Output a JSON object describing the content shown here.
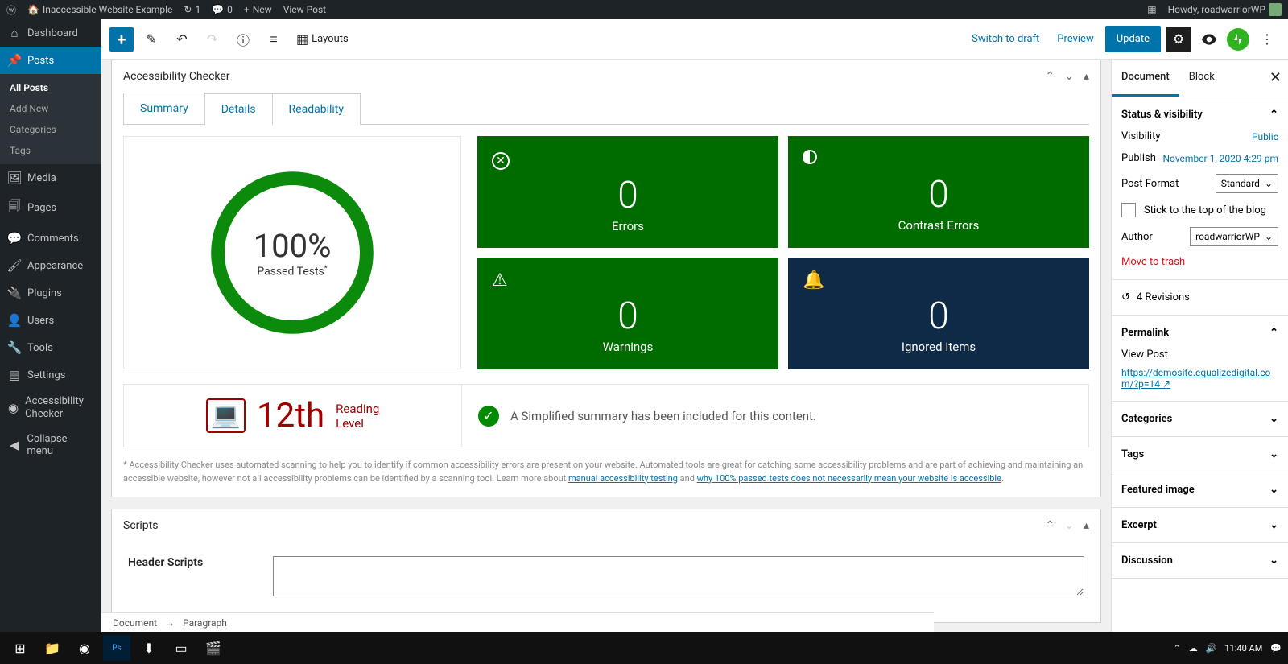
{
  "adminbar": {
    "site_title": "Inaccessible Website Example",
    "updates_count": "1",
    "comments_count": "0",
    "new_label": "New",
    "view_post": "View Post",
    "howdy": "Howdy, roadwarriorWP"
  },
  "sidebar": {
    "items": [
      {
        "icon": "dashboard",
        "label": "Dashboard"
      },
      {
        "icon": "posts",
        "label": "Posts",
        "active": true
      },
      {
        "icon": "media",
        "label": "Media"
      },
      {
        "icon": "pages",
        "label": "Pages"
      },
      {
        "icon": "comments",
        "label": "Comments"
      },
      {
        "icon": "appearance",
        "label": "Appearance"
      },
      {
        "icon": "plugins",
        "label": "Plugins"
      },
      {
        "icon": "users",
        "label": "Users"
      },
      {
        "icon": "tools",
        "label": "Tools"
      },
      {
        "icon": "settings",
        "label": "Settings"
      },
      {
        "icon": "accessibility",
        "label": "Accessibility Checker"
      },
      {
        "icon": "collapse",
        "label": "Collapse menu"
      }
    ],
    "sub_items": [
      {
        "label": "All Posts",
        "current": true
      },
      {
        "label": "Add New"
      },
      {
        "label": "Categories"
      },
      {
        "label": "Tags"
      }
    ]
  },
  "toolbar": {
    "layouts_label": "Layouts",
    "switch_draft": "Switch to draft",
    "preview": "Preview",
    "update": "Update"
  },
  "checker": {
    "panel_title": "Accessibility Checker",
    "tabs": [
      "Summary",
      "Details",
      "Readability"
    ],
    "percent": "100%",
    "passed_label": "Passed Tests",
    "cards": [
      {
        "icon": "x",
        "value": "0",
        "label": "Errors",
        "color": "green"
      },
      {
        "icon": "contrast",
        "value": "0",
        "label": "Contrast Errors",
        "color": "green"
      },
      {
        "icon": "warning",
        "value": "0",
        "label": "Warnings",
        "color": "green"
      },
      {
        "icon": "bell",
        "value": "0",
        "label": "Ignored Items",
        "color": "navy"
      }
    ],
    "reading_grade": "12th",
    "reading_label1": "Reading",
    "reading_label2": "Level",
    "simplified_text": "A Simplified summary has been included for this content.",
    "disclaimer_pre": "* Accessibility Checker uses automated scanning to help you to identify if common accessibility errors are present on your website. Automated tools are great for catching some accessibility problems and are part of achieving and maintaining an accessible website, however not all accessibility problems can be identified by a scanning tool. Learn more about ",
    "disclaimer_link1": "manual accessibility testing",
    "disclaimer_mid": " and ",
    "disclaimer_link2": "why 100% passed tests does not necessarily mean your website is accessible",
    "disclaimer_end": "."
  },
  "scripts_panel": {
    "title": "Scripts",
    "header_scripts_label": "Header Scripts"
  },
  "settings": {
    "tabs": [
      "Document",
      "Block"
    ],
    "status_title": "Status & visibility",
    "visibility_label": "Visibility",
    "visibility_value": "Public",
    "publish_label": "Publish",
    "publish_value": "November 1, 2020 4:29 pm",
    "post_format_label": "Post Format",
    "post_format_value": "Standard",
    "stick_label": "Stick to the top of the blog",
    "author_label": "Author",
    "author_value": "roadwarriorWP",
    "trash_label": "Move to trash",
    "revisions_label": "4 Revisions",
    "permalink_title": "Permalink",
    "view_post_label": "View Post",
    "permalink_url": "https://demosite.equalizedigital.com/?p=14",
    "collapsed_sections": [
      "Categories",
      "Tags",
      "Featured image",
      "Excerpt",
      "Discussion"
    ]
  },
  "breadcrumb": {
    "document": "Document",
    "arrow": "→",
    "paragraph": "Paragraph"
  },
  "taskbar": {
    "time": "11:40 AM"
  },
  "chart_data": {
    "type": "bar",
    "title": "Accessibility Checker Summary",
    "passed_percent": 100,
    "categories": [
      "Errors",
      "Contrast Errors",
      "Warnings",
      "Ignored Items"
    ],
    "values": [
      0,
      0,
      0,
      0
    ],
    "reading_level_grade": 12
  }
}
